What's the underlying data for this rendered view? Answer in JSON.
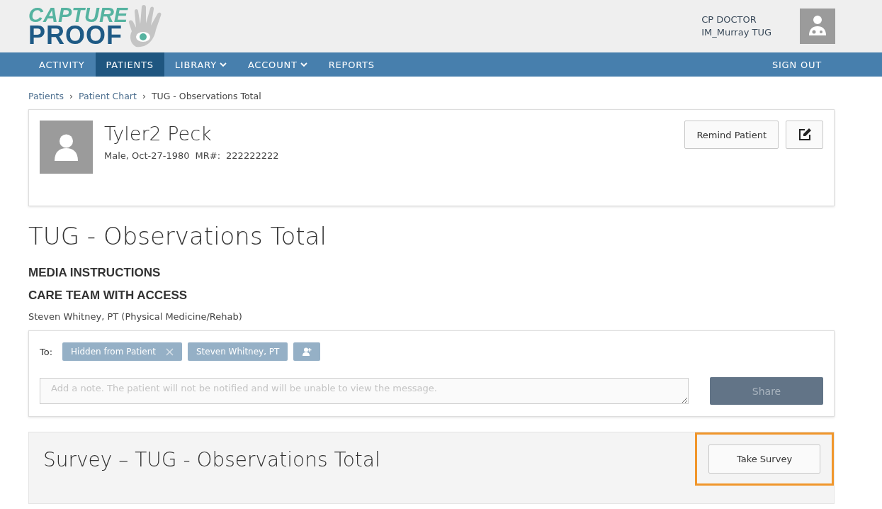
{
  "logo": {
    "line_1": "CAPTURE",
    "line_2": "PROOF"
  },
  "user": {
    "role": "CP DOCTOR",
    "name": "IM_Murray TUG"
  },
  "nav": {
    "items": [
      {
        "label": "ACTIVITY",
        "selected": false,
        "has_menu": false
      },
      {
        "label": "PATIENTS",
        "selected": true,
        "has_menu": false
      },
      {
        "label": "LIBRARY",
        "selected": false,
        "has_menu": true
      },
      {
        "label": "ACCOUNT",
        "selected": false,
        "has_menu": true
      },
      {
        "label": "REPORTS",
        "selected": false,
        "has_menu": false
      }
    ],
    "sign_out": "SIGN OUT"
  },
  "breadcrumb": [
    {
      "label": "Patients",
      "link": true
    },
    {
      "label": "Patient Chart",
      "link": true
    },
    {
      "label": "TUG - Observations Total",
      "link": false
    }
  ],
  "breadcrumb_separator": "›",
  "patient": {
    "name": "Tyler2 Peck",
    "details": "Male, Oct-27-1980",
    "mr_label": "MR#:",
    "mr": "222222222",
    "remind_button": "Remind Patient"
  },
  "page_title": "TUG - Observations Total",
  "sections": [
    "MEDIA INSTRUCTIONS",
    "CARE TEAM WITH ACCESS"
  ],
  "care_team": "Steven Whitney, PT (Physical Medicine/Rehab)",
  "share": {
    "to_label": "To:",
    "recipients": [
      {
        "label": "Hidden from Patient",
        "removable": true
      },
      {
        "label": "Steven Whitney, PT",
        "removable": false
      }
    ],
    "placeholder": "Add a note. The patient will not be notified and will be unable to view the message.",
    "button": "Share",
    "disabled": true
  },
  "survey": {
    "title": "Survey – TUG - Observations Total",
    "button": "Take Survey",
    "highlighted": true
  }
}
